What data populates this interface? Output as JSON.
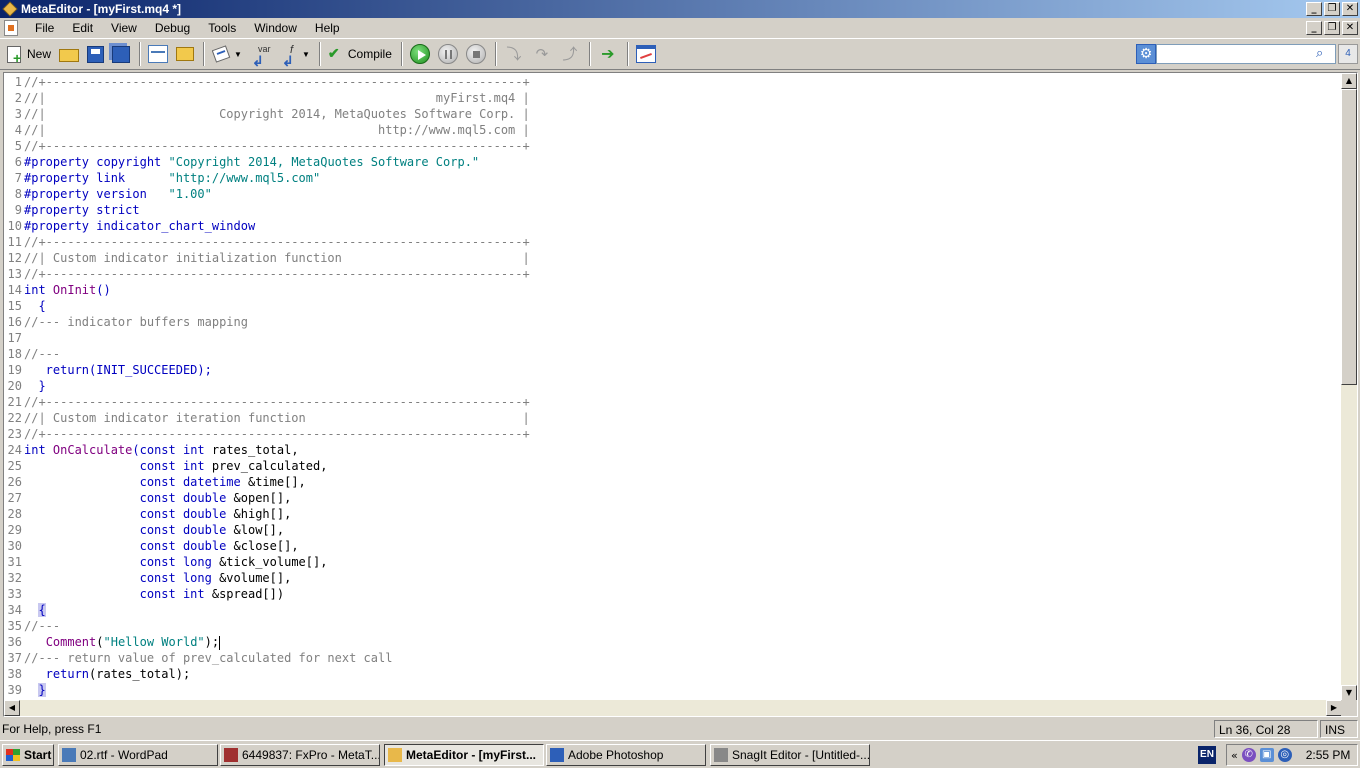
{
  "window": {
    "title": "MetaEditor - [myFirst.mq4 *]"
  },
  "menu": [
    "File",
    "Edit",
    "View",
    "Debug",
    "Tools",
    "Window",
    "Help"
  ],
  "toolbar": {
    "new_label": "New",
    "compile_label": "Compile",
    "var_label": "var"
  },
  "search": {
    "value": "",
    "go_label": "4"
  },
  "editor": {
    "cursor": {
      "line": 36
    },
    "lines": [
      [
        {
          "t": "//+------------------------------------------------------------------+",
          "c": "ct"
        }
      ],
      [
        {
          "t": "//|                                                      myFirst.mq4 |",
          "c": "ct"
        }
      ],
      [
        {
          "t": "//|                        Copyright 2014, MetaQuotes Software Corp. |",
          "c": "ct"
        }
      ],
      [
        {
          "t": "//|                                              http://www.mql5.com |",
          "c": "ct"
        }
      ],
      [
        {
          "t": "//+------------------------------------------------------------------+",
          "c": "ct"
        }
      ],
      [
        {
          "t": "#property copyright ",
          "c": "kw"
        },
        {
          "t": "\"Copyright 2014, MetaQuotes Software Corp.\"",
          "c": "st"
        }
      ],
      [
        {
          "t": "#property link      ",
          "c": "kw"
        },
        {
          "t": "\"http://www.mql5.com\"",
          "c": "st"
        }
      ],
      [
        {
          "t": "#property version   ",
          "c": "kw"
        },
        {
          "t": "\"1.00\"",
          "c": "st"
        }
      ],
      [
        {
          "t": "#property strict",
          "c": "kw"
        }
      ],
      [
        {
          "t": "#property indicator_chart_window",
          "c": "kw"
        }
      ],
      [
        {
          "t": "//+------------------------------------------------------------------+",
          "c": "ct"
        }
      ],
      [
        {
          "t": "//| Custom indicator initialization function                         |",
          "c": "ct"
        }
      ],
      [
        {
          "t": "//+------------------------------------------------------------------+",
          "c": "ct"
        }
      ],
      [
        {
          "t": "int ",
          "c": "kw"
        },
        {
          "t": "OnInit",
          "c": "fn"
        },
        {
          "t": "()",
          "c": "kw"
        }
      ],
      [
        {
          "t": "  {",
          "c": "kw"
        }
      ],
      [
        {
          "t": "//--- indicator buffers mapping",
          "c": "ct"
        }
      ],
      [
        {
          "t": "",
          "c": "nm"
        }
      ],
      [
        {
          "t": "//---",
          "c": "ct"
        }
      ],
      [
        {
          "t": "   return",
          "c": "kw"
        },
        {
          "t": "(INIT_SUCCEEDED);",
          "c": "kw"
        }
      ],
      [
        {
          "t": "  }",
          "c": "kw"
        }
      ],
      [
        {
          "t": "//+------------------------------------------------------------------+",
          "c": "ct"
        }
      ],
      [
        {
          "t": "//| Custom indicator iteration function                              |",
          "c": "ct"
        }
      ],
      [
        {
          "t": "//+------------------------------------------------------------------+",
          "c": "ct"
        }
      ],
      [
        {
          "t": "int ",
          "c": "kw"
        },
        {
          "t": "OnCalculate",
          "c": "fn"
        },
        {
          "t": "(const int ",
          "c": "kw"
        },
        {
          "t": "rates_total,",
          "c": "nm"
        }
      ],
      [
        {
          "t": "                const int ",
          "c": "kw"
        },
        {
          "t": "prev_calculated,",
          "c": "nm"
        }
      ],
      [
        {
          "t": "                const datetime ",
          "c": "kw"
        },
        {
          "t": "&time[],",
          "c": "nm"
        }
      ],
      [
        {
          "t": "                const double ",
          "c": "kw"
        },
        {
          "t": "&open[],",
          "c": "nm"
        }
      ],
      [
        {
          "t": "                const double ",
          "c": "kw"
        },
        {
          "t": "&high[],",
          "c": "nm"
        }
      ],
      [
        {
          "t": "                const double ",
          "c": "kw"
        },
        {
          "t": "&low[],",
          "c": "nm"
        }
      ],
      [
        {
          "t": "                const double ",
          "c": "kw"
        },
        {
          "t": "&close[],",
          "c": "nm"
        }
      ],
      [
        {
          "t": "                const long ",
          "c": "kw"
        },
        {
          "t": "&tick_volume[],",
          "c": "nm"
        }
      ],
      [
        {
          "t": "                const long ",
          "c": "kw"
        },
        {
          "t": "&volume[],",
          "c": "nm"
        }
      ],
      [
        {
          "t": "                const int ",
          "c": "kw"
        },
        {
          "t": "&spread[])",
          "c": "nm"
        }
      ],
      [
        {
          "t": "  ",
          "c": "nm"
        },
        {
          "t": "{",
          "c": "hl"
        }
      ],
      [
        {
          "t": "//---",
          "c": "ct"
        }
      ],
      [
        {
          "t": "   ",
          "c": "nm"
        },
        {
          "t": "Comment",
          "c": "fn"
        },
        {
          "t": "(",
          "c": "nm"
        },
        {
          "t": "\"Hellow World\"",
          "c": "st"
        },
        {
          "t": ");",
          "c": "nm"
        }
      ],
      [
        {
          "t": "//--- return value of prev_calculated for next call",
          "c": "ct"
        }
      ],
      [
        {
          "t": "   return",
          "c": "kw"
        },
        {
          "t": "(rates_total);",
          "c": "nm"
        }
      ],
      [
        {
          "t": "  ",
          "c": "nm"
        },
        {
          "t": "}",
          "c": "hl"
        }
      ]
    ]
  },
  "status": {
    "help": "For Help, press F1",
    "position": "Ln 36, Col 28",
    "mode": "INS"
  },
  "taskbar": {
    "start_label": "Start",
    "tasks": [
      {
        "label": "02.rtf - WordPad",
        "active": false,
        "icon_color": "#4a7ab8"
      },
      {
        "label": "6449837: FxPro - MetaT...",
        "active": false,
        "icon_color": "#a03030"
      },
      {
        "label": "MetaEditor - [myFirst...",
        "active": true,
        "icon_color": "#e8b84a"
      },
      {
        "label": "Adobe Photoshop",
        "active": false,
        "icon_color": "#2d5fb8"
      },
      {
        "label": "SnagIt Editor - [Untitled-...",
        "active": false,
        "icon_color": "#888888"
      }
    ],
    "language": "EN",
    "clock": "2:55 PM"
  }
}
